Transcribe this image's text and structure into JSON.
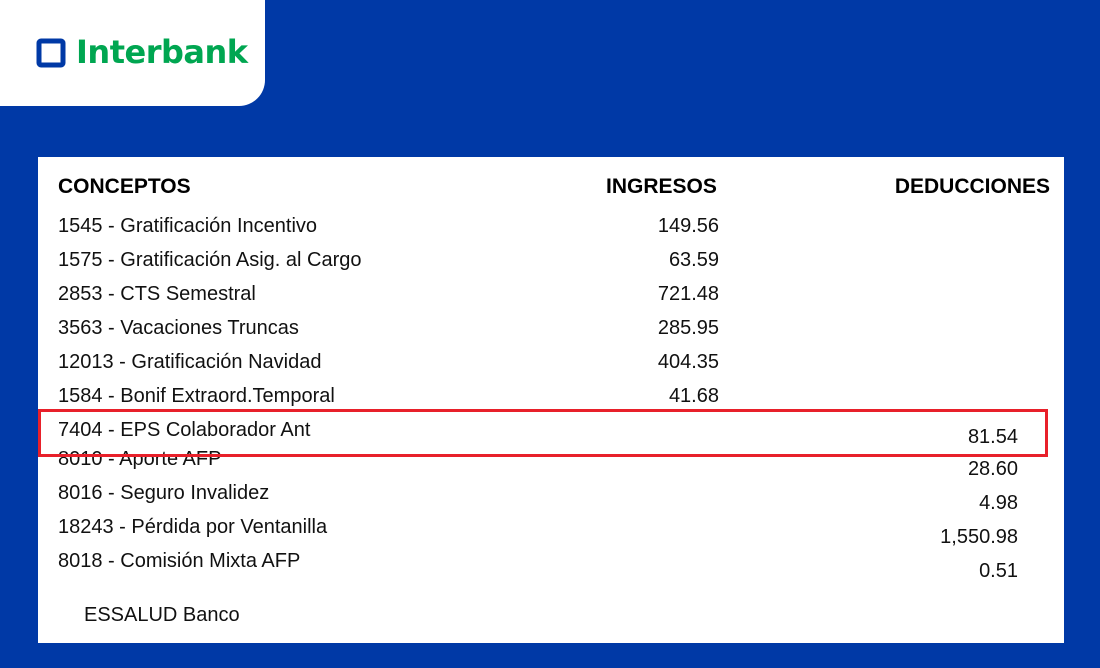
{
  "brand": {
    "name": "Interbank",
    "colors": {
      "background": "#0039a6",
      "logo_green": "#00a651",
      "logo_navy": "#0039a6",
      "highlight": "#e8202a"
    },
    "logo_icon": "square-outline-icon"
  },
  "table": {
    "headers": {
      "concepts": "CONCEPTOS",
      "ingresos": "INGRESOS",
      "deducciones": "DEDUCCIONES"
    },
    "rows": [
      {
        "concept": "1545 - Gratificación Incentivo",
        "ingreso": "149.56",
        "deduccion": ""
      },
      {
        "concept": "1575 - Gratificación Asig. al Cargo",
        "ingreso": "63.59",
        "deduccion": ""
      },
      {
        "concept": "2853 - CTS Semestral",
        "ingreso": "721.48",
        "deduccion": ""
      },
      {
        "concept": "3563 - Vacaciones Truncas",
        "ingreso": "285.95",
        "deduccion": ""
      },
      {
        "concept": "12013 - Gratificación Navidad",
        "ingreso": "404.35",
        "deduccion": ""
      },
      {
        "concept": "1584 - Bonif Extraord.Temporal",
        "ingreso": "41.68",
        "deduccion": ""
      },
      {
        "concept": "7404 - EPS Colaborador Ant",
        "ingreso": "",
        "deduccion": "81.54",
        "highlighted": true
      },
      {
        "concept": "8010 - Aporte AFP",
        "ingreso": "",
        "deduccion": "28.60"
      },
      {
        "concept": "8016 - Seguro Invalidez",
        "ingreso": "",
        "deduccion": "4.98"
      },
      {
        "concept": "18243 - Pérdida por Ventanilla",
        "ingreso": "",
        "deduccion": "1,550.98"
      },
      {
        "concept": "8018 - Comisión Mixta AFP",
        "ingreso": "",
        "deduccion": "0.51"
      }
    ],
    "footer_note": "ESSALUD Banco"
  }
}
